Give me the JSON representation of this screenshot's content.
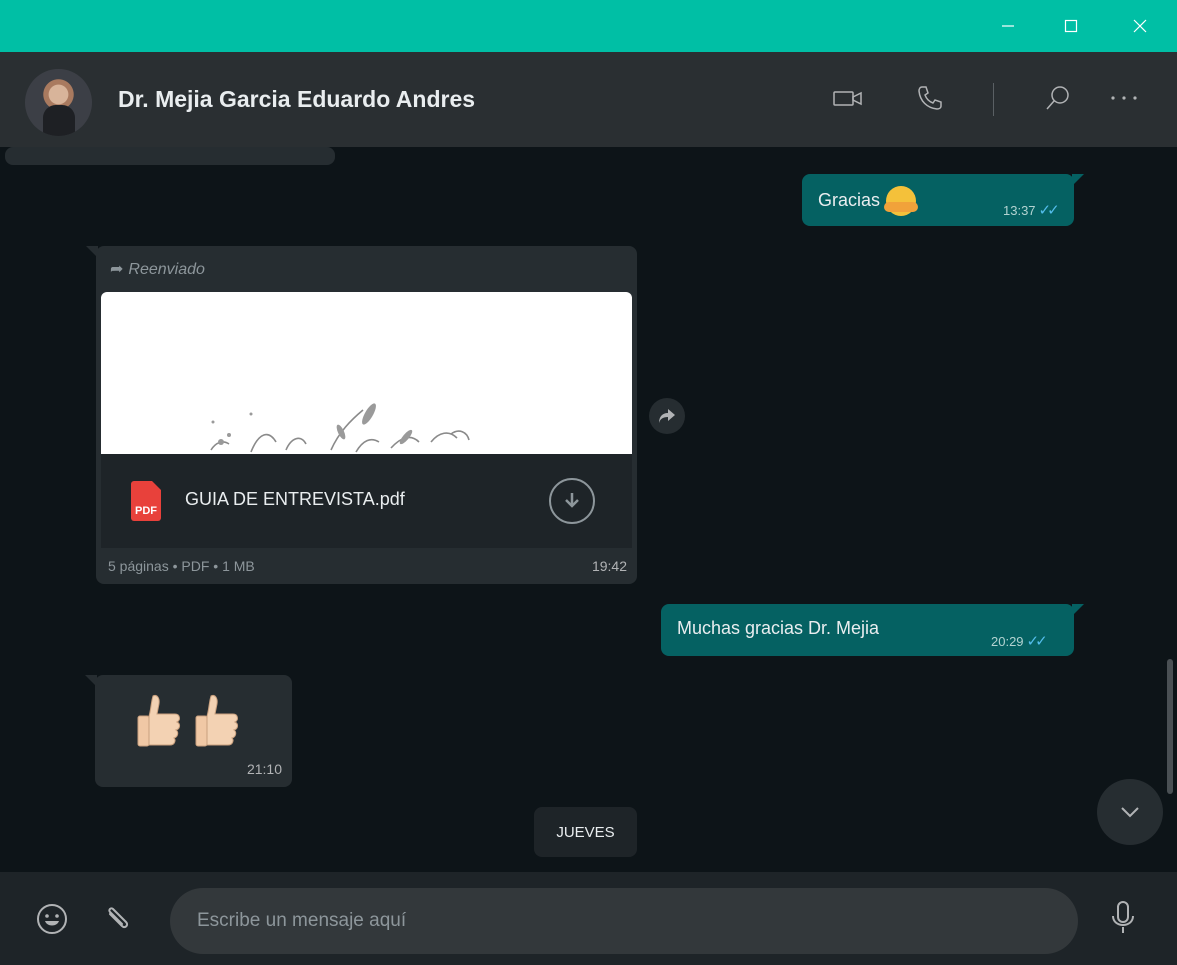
{
  "window": {
    "min_glyph": "—",
    "max_glyph": "☐",
    "close_glyph": "✕"
  },
  "header": {
    "contact_name": "Dr. Mejia Garcia Eduardo Andres"
  },
  "icons": {
    "header": [
      "video-call-icon",
      "phone-icon",
      "search-icon",
      "more-icon"
    ],
    "footer": [
      "emoji-icon",
      "attach-icon",
      "mic-icon"
    ]
  },
  "messages": [
    {
      "direction": "out",
      "text": "Gracias",
      "time": "13:37",
      "status": "read"
    },
    {
      "direction": "in",
      "type": "document",
      "forwarded_label": "Reenviado",
      "file_badge": "PDF",
      "file_name": "GUIA DE ENTREVISTA.pdf",
      "meta": "5 páginas • PDF • 1 MB",
      "time": "19:42"
    },
    {
      "direction": "out",
      "text": "Muchas gracias Dr. Mejia",
      "time": "20:29",
      "status": "read"
    },
    {
      "direction": "in",
      "type": "emoji",
      "emoji": "thumbs-up x2",
      "time": "21:10"
    }
  ],
  "date_separator": "JUEVES",
  "composer": {
    "placeholder": "Escribe un mensaje aquí"
  },
  "colors": {
    "titlebar": "#00bfa5",
    "header": "#2a2f32",
    "chat_bg": "#0d1418",
    "outgoing": "#056162",
    "incoming": "#262d31",
    "read_ticks": "#53bdeb"
  }
}
